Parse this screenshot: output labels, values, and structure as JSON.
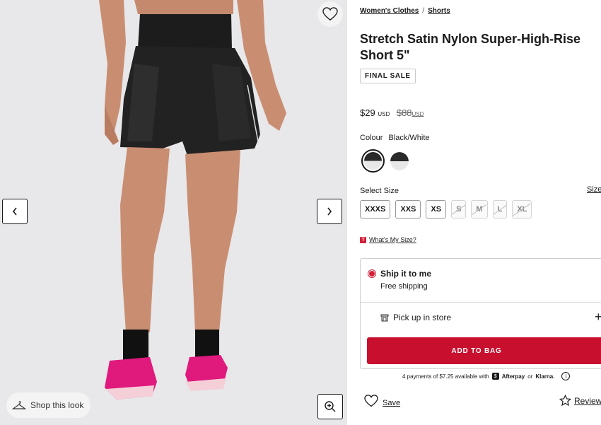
{
  "gallery": {
    "shop_look_label": "Shop this look",
    "icons": {
      "favorite": "heart-icon",
      "prev": "chevron-left-icon",
      "next": "chevron-right-icon",
      "shop_look": "hanger-icon",
      "zoom": "zoom-in-icon"
    }
  },
  "breadcrumb": {
    "items": [
      "Women's Clothes",
      "Shorts"
    ],
    "separator": "/"
  },
  "product": {
    "title_line1": "Stretch Satin Nylon Super-High-Rise",
    "title_line2": "Short 5\"",
    "badge": "FINAL SALE",
    "price": "$29",
    "price_currency": "USD",
    "original_price": "$88",
    "original_currency": "USD"
  },
  "colour": {
    "label": "Colour",
    "value": "Black/White"
  },
  "size": {
    "label": "Select Size",
    "guide_label": "Size",
    "options": [
      {
        "label": "XXXS",
        "available": true
      },
      {
        "label": "XXS",
        "available": true
      },
      {
        "label": "XS",
        "available": true
      },
      {
        "label": "S",
        "available": false
      },
      {
        "label": "M",
        "available": false
      },
      {
        "label": "L",
        "available": false
      },
      {
        "label": "XL",
        "available": false
      }
    ],
    "whats_my_size": "What's My Size?",
    "whats_my_size_tag": "T"
  },
  "shipping": {
    "ship_title": "Ship it to me",
    "ship_sub": "Free shipping",
    "pickup_label": "Pick up in store",
    "pickup_action": "+",
    "add_to_bag": "ADD TO BAG"
  },
  "payments": {
    "prefix": "4 payments of $7.25 available with",
    "afterpay_badge": "$",
    "afterpay": "Afterpay",
    "or": "or",
    "klarna": "Klarna.",
    "info": "i"
  },
  "actions": {
    "save_label": "Save",
    "reviews_label": "Review"
  },
  "colors": {
    "accent": "#c8102e",
    "radio": "#d5203a",
    "text": "#1a1a1a",
    "shoe_pink": "#e0197d"
  }
}
